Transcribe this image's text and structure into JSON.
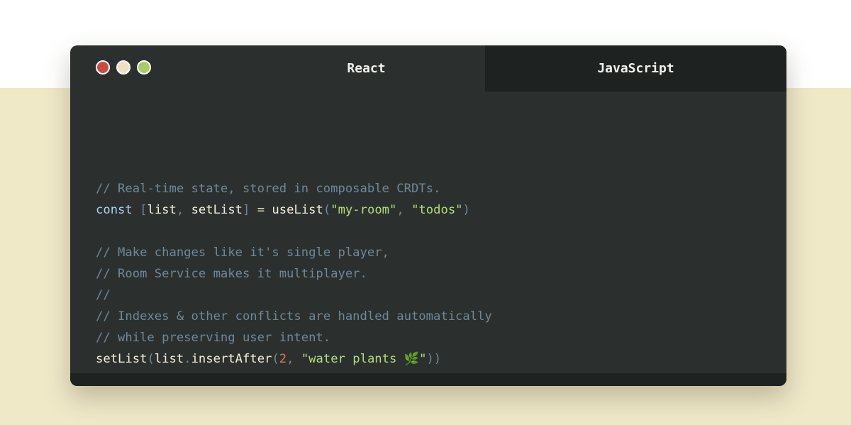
{
  "window": {
    "controls": [
      "close",
      "minimize",
      "maximize"
    ],
    "tabs": [
      {
        "label": "React",
        "active": true
      },
      {
        "label": "JavaScript",
        "active": false
      }
    ]
  },
  "code": {
    "lines": [
      [],
      [],
      [
        {
          "t": "// Real-time state, stored in composable CRDTs.",
          "c": "comment"
        }
      ],
      [
        {
          "t": "const",
          "c": "keyword"
        },
        {
          "t": " ",
          "c": "ident"
        },
        {
          "t": "[",
          "c": "punct"
        },
        {
          "t": "list",
          "c": "ident"
        },
        {
          "t": ",",
          "c": "punct"
        },
        {
          "t": " setList",
          "c": "ident"
        },
        {
          "t": "]",
          "c": "punct"
        },
        {
          "t": " = useList",
          "c": "ident"
        },
        {
          "t": "(",
          "c": "punct"
        },
        {
          "t": "\"my-room\"",
          "c": "string"
        },
        {
          "t": ", ",
          "c": "punct"
        },
        {
          "t": "\"todos\"",
          "c": "string"
        },
        {
          "t": ")",
          "c": "punct"
        }
      ],
      [],
      [
        {
          "t": "// Make changes like it's single player,",
          "c": "comment"
        }
      ],
      [
        {
          "t": "// Room Service makes it multiplayer.",
          "c": "comment"
        }
      ],
      [
        {
          "t": "//",
          "c": "comment"
        }
      ],
      [
        {
          "t": "// Indexes & other conflicts are handled automatically",
          "c": "comment"
        }
      ],
      [
        {
          "t": "// while preserving user intent.",
          "c": "comment"
        }
      ],
      [
        {
          "t": "setList",
          "c": "ident"
        },
        {
          "t": "(",
          "c": "punct"
        },
        {
          "t": "list",
          "c": "ident"
        },
        {
          "t": ".",
          "c": "punct"
        },
        {
          "t": "insertAfter",
          "c": "ident"
        },
        {
          "t": "(",
          "c": "punct"
        },
        {
          "t": "2",
          "c": "number"
        },
        {
          "t": ", ",
          "c": "punct"
        },
        {
          "t": "\"water plants 🌿\"",
          "c": "string"
        },
        {
          "t": "))",
          "c": "punct"
        }
      ]
    ]
  }
}
